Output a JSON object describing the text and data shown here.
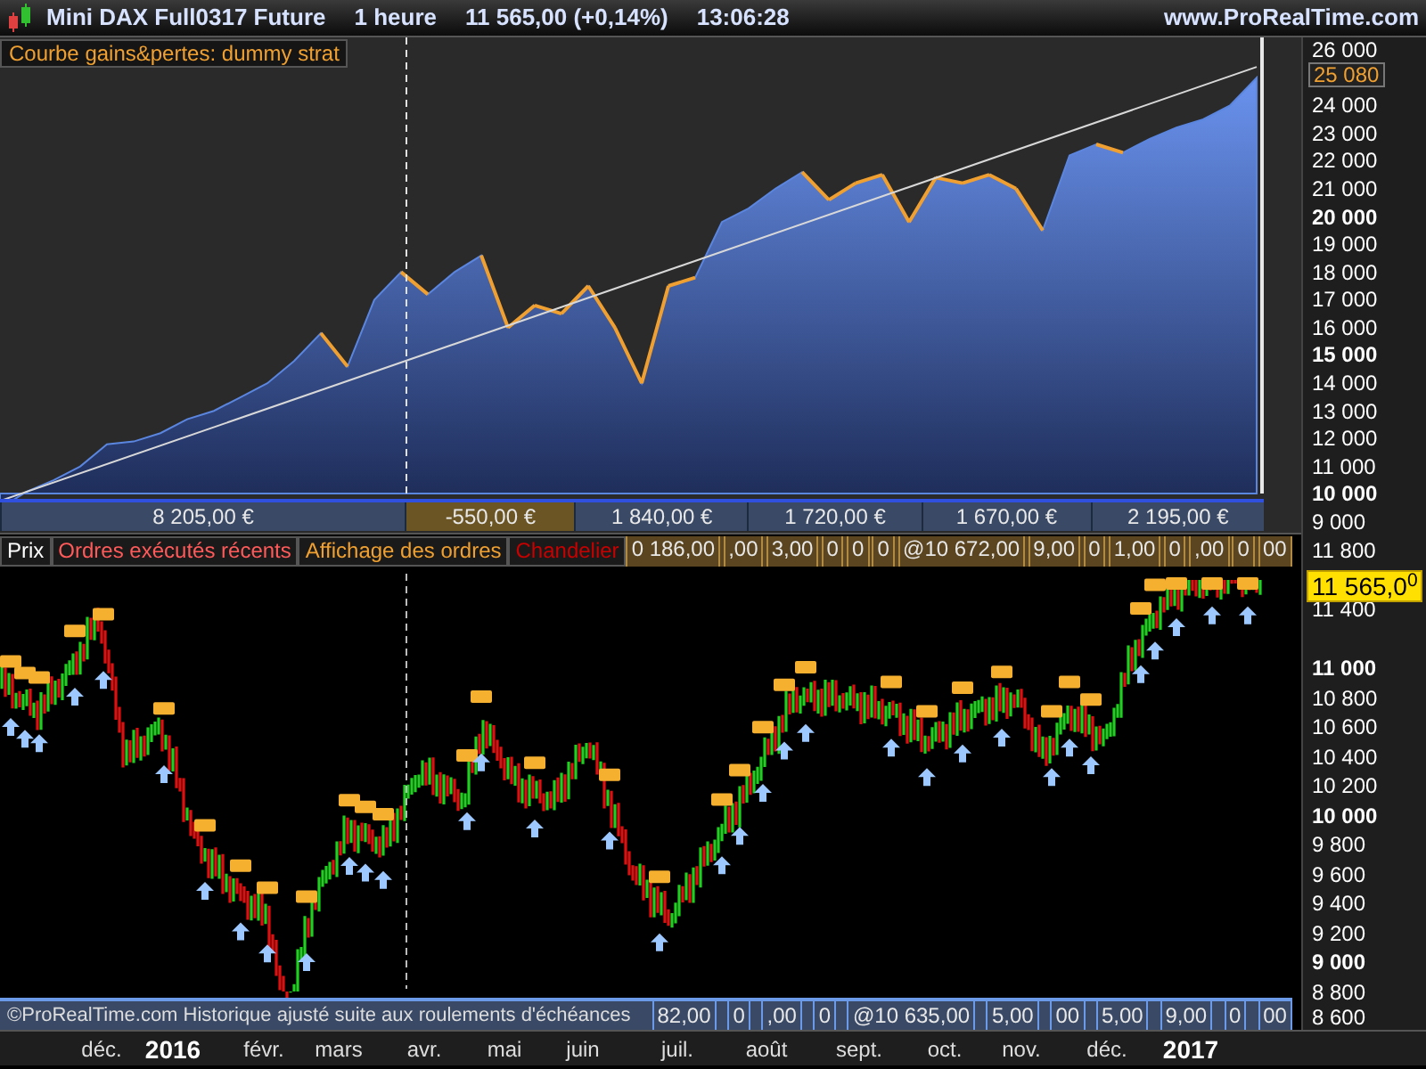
{
  "title_bar": {
    "instrument": "Mini DAX Full0317 Future",
    "period": "1 heure",
    "price": "11 565,00 (+0,14%)",
    "time": "13:06:28",
    "site": "www.ProRealTime.com"
  },
  "equity_panel": {
    "label": "Courbe gains&pertes: dummy strat",
    "current_value": "25 080",
    "value_axis": [
      {
        "label": "26 000",
        "bold": false
      },
      {
        "label": "24 000",
        "bold": false
      },
      {
        "label": "23 000",
        "bold": false
      },
      {
        "label": "22 000",
        "bold": false
      },
      {
        "label": "21 000",
        "bold": false
      },
      {
        "label": "20 000",
        "bold": true
      },
      {
        "label": "19 000",
        "bold": false
      },
      {
        "label": "18 000",
        "bold": false
      },
      {
        "label": "17 000",
        "bold": false
      },
      {
        "label": "16 000",
        "bold": false
      },
      {
        "label": "15 000",
        "bold": true
      },
      {
        "label": "14 000",
        "bold": false
      },
      {
        "label": "13 000",
        "bold": false
      },
      {
        "label": "12 000",
        "bold": false
      },
      {
        "label": "11 000",
        "bold": false
      },
      {
        "label": "10 000",
        "bold": true
      },
      {
        "label": "9 000",
        "bold": false
      }
    ],
    "trades": [
      {
        "label": "8 205,00 €",
        "selected": false
      },
      {
        "label": "-550,00 €",
        "selected": true
      },
      {
        "label": "1 840,00 €",
        "selected": false
      },
      {
        "label": "1 720,00 €",
        "selected": false
      },
      {
        "label": "1 670,00 €",
        "selected": false
      },
      {
        "label": "2 195,00 €",
        "selected": false
      }
    ]
  },
  "price_panel": {
    "tabs": [
      {
        "label": "Prix",
        "color": "#ffffff"
      },
      {
        "label": "Ordres exécutés récents",
        "color": "#ff5a5a"
      },
      {
        "label": "Affichage des ordres",
        "color": "#f0a030"
      },
      {
        "label": "Chandelier",
        "color": "#c80000"
      }
    ],
    "top_order_tags": [
      "0 186,00",
      ",00",
      "3,00",
      "0",
      "0",
      "0",
      "@10 672,00",
      "9,00",
      "0",
      "1,00",
      "0",
      ",00",
      "0",
      "00"
    ],
    "bottom_order_tags": [
      "82,00",
      "0",
      ",00",
      "0",
      "@10 635,00",
      "5,00",
      "00",
      "5,00",
      "9,00",
      "0",
      "00"
    ],
    "notice": "©ProRealTime.com Historique ajusté suite aux roulements d'échéances",
    "current_price": "11 565,0$^{0}$",
    "price_axis": [
      {
        "label": "11 800",
        "bold": false
      },
      {
        "label": "11 400",
        "bold": false
      },
      {
        "label": "11 000",
        "bold": true
      },
      {
        "label": "10 800",
        "bold": false
      },
      {
        "label": "10 600",
        "bold": false
      },
      {
        "label": "10 400",
        "bold": false
      },
      {
        "label": "10 200",
        "bold": false
      },
      {
        "label": "10 000",
        "bold": true
      },
      {
        "label": "9 800",
        "bold": false
      },
      {
        "label": "9 600",
        "bold": false
      },
      {
        "label": "9 400",
        "bold": false
      },
      {
        "label": "9 200",
        "bold": false
      },
      {
        "label": "9 000",
        "bold": true
      },
      {
        "label": "8 800",
        "bold": false
      },
      {
        "label": "8 600",
        "bold": false
      }
    ],
    "time_axis": [
      {
        "label": "déc.",
        "kind": "month"
      },
      {
        "label": "2016",
        "kind": "year"
      },
      {
        "label": "févr.",
        "kind": "month"
      },
      {
        "label": "mars",
        "kind": "month"
      },
      {
        "label": "avr.",
        "kind": "month"
      },
      {
        "label": "mai",
        "kind": "month"
      },
      {
        "label": "juin",
        "kind": "month"
      },
      {
        "label": "juil.",
        "kind": "month"
      },
      {
        "label": "août",
        "kind": "month"
      },
      {
        "label": "sept.",
        "kind": "month"
      },
      {
        "label": "oct.",
        "kind": "month"
      },
      {
        "label": "nov.",
        "kind": "month"
      },
      {
        "label": "déc.",
        "kind": "month"
      },
      {
        "label": "2017",
        "kind": "year"
      }
    ]
  }
}
